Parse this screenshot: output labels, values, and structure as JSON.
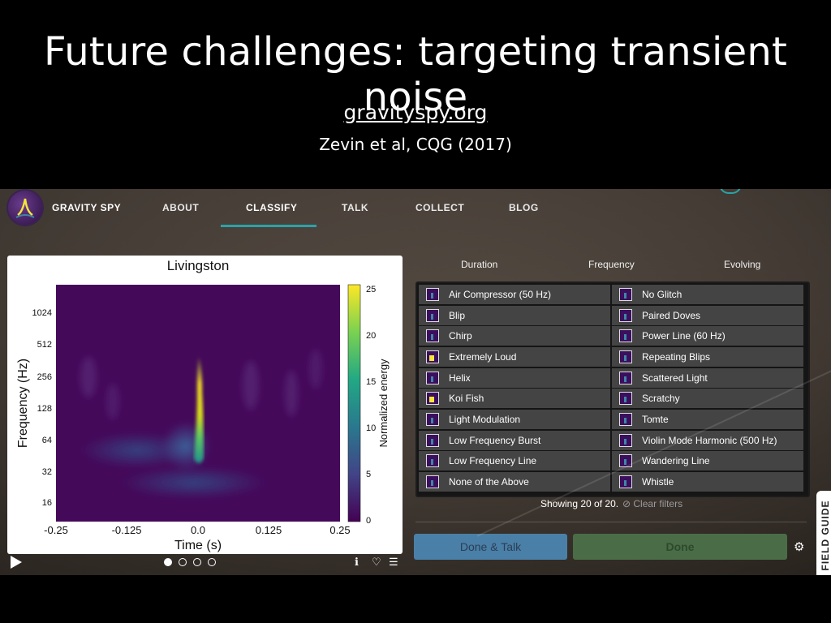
{
  "slide": {
    "title": "Future challenges: targeting transient noise",
    "link": "gravityspy.org",
    "citation": "Zevin et al, CQG (2017)"
  },
  "nav": {
    "brand": "GRAVITY SPY",
    "items": [
      "ABOUT",
      "CLASSIFY",
      "TALK",
      "COLLECT",
      "BLOG"
    ],
    "active": "CLASSIFY"
  },
  "plot": {
    "title": "Livingston",
    "xlabel": "Time (s)",
    "ylabel": "Frequency (Hz)",
    "colorbar_label": "Normalized energy"
  },
  "chart_data": {
    "type": "heatmap",
    "title": "Livingston",
    "xlabel": "Time (s)",
    "ylabel": "Frequency (Hz)",
    "x_ticks": [
      "-0.25",
      "-0.125",
      "0.0",
      "0.125",
      "0.25"
    ],
    "y_ticks": [
      "16",
      "32",
      "64",
      "128",
      "256",
      "512",
      "1024"
    ],
    "y_scale": "log2",
    "colorbar": {
      "label": "Normalized energy",
      "range": [
        0,
        25.5
      ],
      "ticks": [
        "0",
        "5",
        "10",
        "15",
        "20",
        "25"
      ]
    },
    "colormap": "viridis"
  },
  "columns": {
    "duration": "Duration",
    "frequency": "Frequency",
    "evolving": "Evolving"
  },
  "categories_left": [
    "Air Compressor (50 Hz)",
    "Blip",
    "Chirp",
    "Extremely Loud",
    "Helix",
    "Koi Fish",
    "Light Modulation",
    "Low Frequency Burst",
    "Low Frequency Line",
    "None of the Above"
  ],
  "categories_right": [
    "No Glitch",
    "Paired Doves",
    "Power Line (60 Hz)",
    "Repeating Blips",
    "Scattered Light",
    "Scratchy",
    "Tomte",
    "Violin Mode Harmonic (500 Hz)",
    "Wandering Line",
    "Whistle"
  ],
  "status": {
    "showing": "Showing 20 of 20.",
    "clear": "⊘ Clear filters"
  },
  "buttons": {
    "done_talk": "Done & Talk",
    "done": "Done"
  },
  "field_guide": "FIELD GUIDE",
  "icons": {
    "play": "play-icon",
    "info": "ℹ",
    "favorite": "♡",
    "collect": "☰",
    "settings": "⚙"
  },
  "colors": {
    "accent": "#2aa3a8",
    "done_talk": "#4a7fa7",
    "done": "#4a6d47"
  }
}
